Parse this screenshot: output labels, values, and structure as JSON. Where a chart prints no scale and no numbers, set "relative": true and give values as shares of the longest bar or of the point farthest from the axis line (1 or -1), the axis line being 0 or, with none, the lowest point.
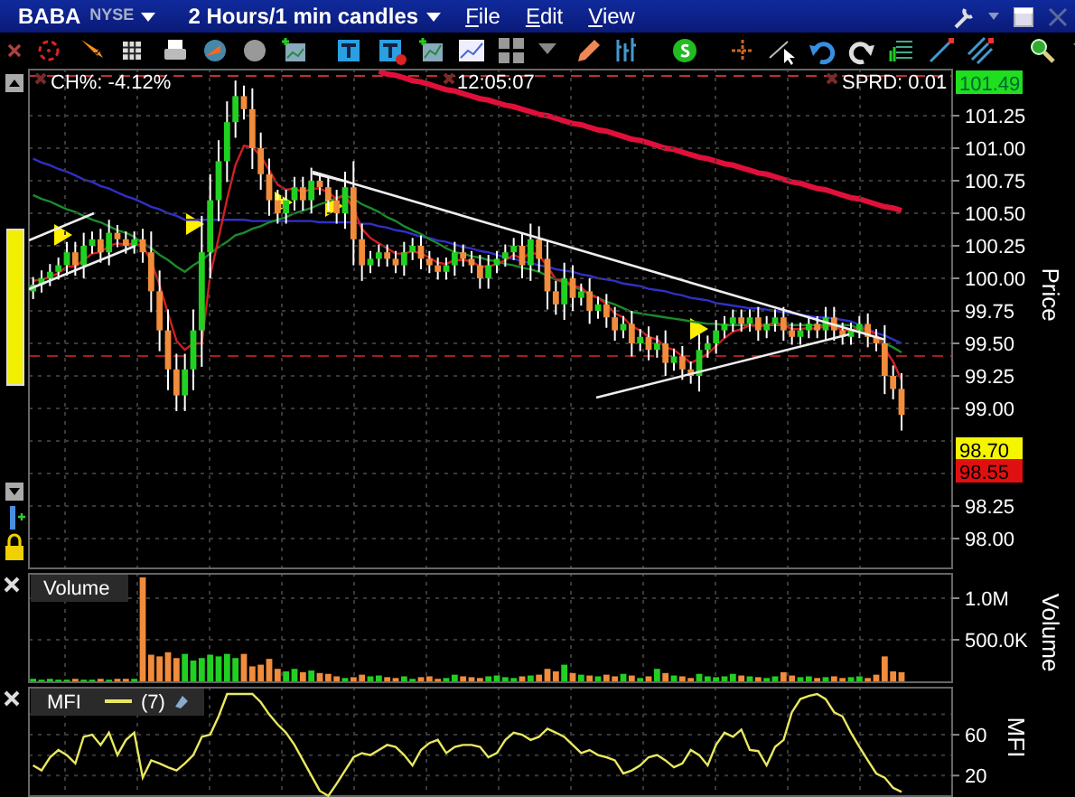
{
  "header": {
    "symbol": "BABA",
    "exchange": "NYSE",
    "timeframe": "2 Hours/1 min candles",
    "menu": [
      "File",
      "Edit",
      "View"
    ]
  },
  "price_panel": {
    "change": "CH%: -4.12%",
    "time": "12:05:07",
    "spread": "SPRD: 0.01",
    "price_labels": [
      {
        "text": "101.49",
        "color": "#1ee01e"
      },
      {
        "text": "98.70",
        "color": "#f5f500"
      },
      {
        "text": "98.55",
        "color": "#e01010"
      }
    ],
    "chart_data": {
      "type": "candlestick",
      "ylabel": "Price",
      "ylim": [
        97.764,
        101.611
      ],
      "grid": true,
      "categories": [
        null,
        null,
        null,
        null,
        null,
        null,
        null,
        null,
        null,
        null,
        null,
        null,
        null,
        null,
        null,
        null,
        null,
        null,
        null,
        null,
        null,
        null,
        null,
        null,
        null,
        null,
        null,
        null,
        null,
        null,
        null,
        null,
        null,
        null,
        null,
        null,
        null,
        null,
        null,
        null,
        null,
        null,
        null,
        null,
        null,
        null,
        null,
        null,
        null,
        null,
        null,
        null,
        null,
        null,
        null,
        null,
        null,
        null,
        null,
        null,
        null,
        null,
        null,
        null,
        null,
        null,
        null,
        null,
        null,
        null,
        null,
        null,
        null,
        null,
        null,
        null,
        null,
        null,
        null,
        null,
        null,
        null,
        null,
        null,
        null,
        null,
        null,
        null,
        null,
        null,
        null,
        null,
        null,
        null,
        null,
        null,
        null,
        null,
        null,
        null,
        null,
        null,
        null,
        null
      ],
      "yticks": [
        {
          "value": 98,
          "label": "98.00"
        },
        {
          "value": 98.25,
          "label": "98.25"
        },
        {
          "value": 99,
          "label": "99.00"
        },
        {
          "value": 99.25,
          "label": "99.25"
        },
        {
          "value": 99.5,
          "label": "99.50"
        },
        {
          "value": 99.75,
          "label": "99.75"
        },
        {
          "value": 100,
          "label": "100.00"
        },
        {
          "value": 100.25,
          "label": "100.25"
        },
        {
          "value": 100.5,
          "label": "100.50"
        },
        {
          "value": 100.75,
          "label": "100.75"
        },
        {
          "value": 101,
          "label": "101.00"
        },
        {
          "value": 101.25,
          "label": "101.25"
        }
      ],
      "ohlc": [
        [
          99.9,
          100.01,
          99.84,
          99.95
        ],
        [
          99.95,
          100.06,
          99.89,
          100.0
        ],
        [
          100.0,
          100.11,
          99.94,
          100.05
        ],
        [
          100.05,
          100.16,
          99.99,
          100.1
        ],
        [
          100.1,
          100.28,
          100.02,
          100.2
        ],
        [
          100.2,
          100.28,
          100.02,
          100.1
        ],
        [
          100.1,
          100.35,
          100.0,
          100.25
        ],
        [
          100.25,
          100.36,
          100.19,
          100.3
        ],
        [
          100.3,
          100.38,
          100.12,
          100.2
        ],
        [
          100.2,
          100.45,
          100.1,
          100.35
        ],
        [
          100.35,
          100.41,
          100.24,
          100.3
        ],
        [
          100.3,
          100.36,
          100.19,
          100.25
        ],
        [
          100.25,
          100.36,
          100.19,
          100.3
        ],
        [
          100.3,
          100.38,
          100.12,
          100.2
        ],
        [
          100.2,
          100.36,
          99.74,
          99.9
        ],
        [
          99.9,
          100.06,
          99.44,
          99.6
        ],
        [
          99.6,
          99.76,
          99.14,
          99.3
        ],
        [
          99.3,
          99.42,
          98.98,
          99.1
        ],
        [
          99.1,
          99.42,
          98.98,
          99.3
        ],
        [
          99.3,
          99.76,
          99.14,
          99.6
        ],
        [
          99.6,
          100.48,
          99.32,
          100.2
        ],
        [
          100.2,
          100.8,
          100.0,
          100.6
        ],
        [
          100.6,
          101.06,
          100.44,
          100.9
        ],
        [
          100.9,
          101.36,
          100.74,
          101.2
        ],
        [
          101.2,
          101.52,
          101.08,
          101.4
        ],
        [
          101.4,
          101.48,
          101.22,
          101.3
        ],
        [
          101.3,
          101.46,
          100.84,
          101.0
        ],
        [
          101.0,
          101.12,
          100.68,
          100.8
        ],
        [
          100.8,
          100.92,
          100.48,
          100.6
        ],
        [
          100.6,
          100.68,
          100.42,
          100.5
        ],
        [
          100.5,
          100.68,
          100.42,
          100.6
        ],
        [
          100.6,
          100.78,
          100.52,
          100.7
        ],
        [
          100.7,
          100.78,
          100.52,
          100.6
        ],
        [
          100.6,
          100.85,
          100.5,
          100.75
        ],
        [
          100.75,
          100.81,
          100.64,
          100.7
        ],
        [
          100.7,
          100.78,
          100.52,
          100.6
        ],
        [
          100.6,
          100.68,
          100.42,
          100.5
        ],
        [
          100.5,
          100.82,
          100.38,
          100.7
        ],
        [
          100.7,
          100.9,
          100.1,
          100.3
        ],
        [
          100.3,
          100.42,
          99.98,
          100.1
        ],
        [
          100.1,
          100.21,
          100.04,
          100.15
        ],
        [
          100.15,
          100.26,
          100.09,
          100.2
        ],
        [
          100.2,
          100.26,
          100.09,
          100.15
        ],
        [
          100.15,
          100.21,
          100.04,
          100.1
        ],
        [
          100.1,
          100.28,
          100.02,
          100.2
        ],
        [
          100.2,
          100.31,
          100.14,
          100.25
        ],
        [
          100.25,
          100.33,
          100.07,
          100.15
        ],
        [
          100.15,
          100.21,
          100.04,
          100.1
        ],
        [
          100.1,
          100.16,
          99.99,
          100.05
        ],
        [
          100.05,
          100.16,
          99.99,
          100.1
        ],
        [
          100.1,
          100.28,
          100.02,
          100.2
        ],
        [
          100.2,
          100.26,
          100.09,
          100.15
        ],
        [
          100.15,
          100.21,
          100.04,
          100.1
        ],
        [
          100.1,
          100.18,
          99.92,
          100.0
        ],
        [
          100.0,
          100.18,
          99.92,
          100.1
        ],
        [
          100.1,
          100.21,
          100.04,
          100.15
        ],
        [
          100.15,
          100.26,
          100.09,
          100.2
        ],
        [
          100.2,
          100.31,
          100.14,
          100.25
        ],
        [
          100.25,
          100.35,
          100.0,
          100.1
        ],
        [
          100.1,
          100.42,
          99.98,
          100.3
        ],
        [
          100.3,
          100.4,
          100.05,
          100.15
        ],
        [
          100.15,
          100.29,
          99.76,
          99.9
        ],
        [
          99.9,
          99.98,
          99.72,
          99.8
        ],
        [
          99.8,
          100.12,
          99.68,
          100.0
        ],
        [
          100.0,
          100.1,
          99.75,
          99.85
        ],
        [
          99.85,
          99.96,
          99.79,
          99.9
        ],
        [
          99.9,
          100.0,
          99.65,
          99.75
        ],
        [
          99.75,
          99.86,
          99.69,
          99.8
        ],
        [
          99.8,
          99.88,
          99.62,
          99.7
        ],
        [
          99.7,
          99.78,
          99.52,
          99.6
        ],
        [
          99.6,
          99.71,
          99.54,
          99.65
        ],
        [
          99.65,
          99.75,
          99.4,
          99.5
        ],
        [
          99.5,
          99.61,
          99.44,
          99.55
        ],
        [
          99.55,
          99.63,
          99.37,
          99.45
        ],
        [
          99.45,
          99.56,
          99.39,
          99.5
        ],
        [
          99.5,
          99.6,
          99.25,
          99.35
        ],
        [
          99.35,
          99.46,
          99.29,
          99.4
        ],
        [
          99.4,
          99.48,
          99.22,
          99.3
        ],
        [
          99.3,
          99.36,
          99.19,
          99.25
        ],
        [
          99.25,
          99.57,
          99.13,
          99.45
        ],
        [
          99.45,
          99.56,
          99.39,
          99.5
        ],
        [
          99.5,
          99.68,
          99.42,
          99.6
        ],
        [
          99.6,
          99.71,
          99.54,
          99.65
        ],
        [
          99.65,
          99.76,
          99.59,
          99.7
        ],
        [
          99.7,
          99.76,
          99.59,
          99.65
        ],
        [
          99.65,
          99.76,
          99.59,
          99.7
        ],
        [
          99.7,
          99.78,
          99.52,
          99.6
        ],
        [
          99.6,
          99.71,
          99.54,
          99.65
        ],
        [
          99.65,
          99.76,
          99.59,
          99.7
        ],
        [
          99.7,
          99.78,
          99.52,
          99.6
        ],
        [
          99.6,
          99.66,
          99.49,
          99.55
        ],
        [
          99.55,
          99.66,
          99.49,
          99.6
        ],
        [
          99.6,
          99.71,
          99.54,
          99.65
        ],
        [
          99.65,
          99.71,
          99.54,
          99.6
        ],
        [
          99.6,
          99.78,
          99.52,
          99.7
        ],
        [
          99.7,
          99.78,
          99.52,
          99.6
        ],
        [
          99.6,
          99.66,
          99.49,
          99.55
        ],
        [
          99.55,
          99.66,
          99.49,
          99.6
        ],
        [
          99.6,
          99.71,
          99.54,
          99.65
        ],
        [
          99.65,
          99.73,
          99.47,
          99.55
        ],
        [
          99.55,
          99.61,
          99.44,
          99.5
        ],
        [
          99.5,
          99.64,
          99.11,
          99.25
        ],
        [
          99.25,
          99.33,
          99.07,
          99.15
        ],
        [
          99.15,
          99.27,
          98.83,
          98.95
        ]
      ]
    },
    "averages": {
      "chart_data": {
        "type": "line",
        "relative": true,
        "ylim": [
          97.764,
          101.611
        ],
        "series": [
          {
            "color": "#3030c8",
            "values": [
              100.92,
              100.89,
              100.87,
              100.84,
              100.82,
              100.79,
              100.76,
              100.74,
              100.71,
              100.69,
              100.66,
              100.63,
              100.61,
              100.58,
              100.55,
              100.53,
              100.5,
              100.48,
              100.45,
              100.45,
              100.45,
              100.45,
              100.45,
              100.45,
              100.45,
              100.45,
              100.44,
              100.44,
              100.44,
              100.44,
              100.44,
              100.44,
              100.44,
              100.44,
              100.43,
              100.43,
              100.43,
              100.43,
              100.43,
              100.42,
              100.42,
              100.4,
              100.39,
              100.37,
              100.36,
              100.34,
              100.32,
              100.31,
              100.29,
              100.28,
              100.26,
              100.24,
              100.23,
              100.21,
              100.2,
              100.18,
              100.16,
              100.15,
              100.13,
              100.12,
              100.1,
              100.09,
              100.07,
              100.06,
              100.05,
              100.03,
              100.02,
              100.0,
              99.99,
              99.98,
              99.96,
              99.95,
              99.94,
              99.92,
              99.91,
              99.9,
              99.88,
              99.87,
              99.85,
              99.84,
              99.83,
              99.81,
              99.8,
              99.79,
              99.78,
              99.77,
              99.77,
              99.76,
              99.75,
              99.74,
              99.73,
              99.72,
              99.71,
              99.7,
              99.7,
              99.69,
              99.68,
              99.67,
              99.64,
              99.61,
              99.58,
              99.56,
              99.53,
              99.5
            ]
          },
          {
            "color": "#1c8a2c",
            "values": [
              100.64,
              100.61,
              100.59,
              100.56,
              100.53,
              100.51,
              100.48,
              100.45,
              100.43,
              100.4,
              100.37,
              100.35,
              100.32,
              100.27,
              100.23,
              100.18,
              100.14,
              100.09,
              100.05,
              100.1,
              100.14,
              100.19,
              100.24,
              100.28,
              100.33,
              100.35,
              100.38,
              100.4,
              100.43,
              100.45,
              100.47,
              100.5,
              100.52,
              100.54,
              100.57,
              100.59,
              100.62,
              100.64,
              100.61,
              100.57,
              100.54,
              100.51,
              100.47,
              100.44,
              100.4,
              100.37,
              100.34,
              100.3,
              100.27,
              100.23,
              100.2,
              100.19,
              100.17,
              100.16,
              100.14,
              100.13,
              100.11,
              100.1,
              100.08,
              100.07,
              100.05,
              100.02,
              99.99,
              99.97,
              99.94,
              99.91,
              99.88,
              99.85,
              99.82,
              99.8,
              99.77,
              99.74,
              99.73,
              99.72,
              99.71,
              99.7,
              99.69,
              99.68,
              99.67,
              99.66,
              99.65,
              99.65,
              99.64,
              99.64,
              99.64,
              99.64,
              99.64,
              99.64,
              99.64,
              99.64,
              99.64,
              99.64,
              99.64,
              99.64,
              99.64,
              99.64,
              99.64,
              99.64,
              99.61,
              99.57,
              99.54,
              99.5,
              99.47,
              99.43
            ]
          },
          {
            "color": "#d02020",
            "values": [
              99.98,
              99.99,
              100.01,
              100.04,
              100.09,
              100.09,
              100.14,
              100.19,
              100.2,
              100.25,
              100.27,
              100.26,
              100.27,
              100.25,
              100.13,
              99.95,
              99.73,
              99.52,
              99.45,
              99.5,
              99.5,
              100.02,
              100.31,
              100.61,
              100.87,
              101.02,
              101.01,
              100.94,
              100.83,
              100.72,
              100.68,
              100.69,
              100.66,
              100.69,
              100.69,
              100.66,
              100.61,
              100.64,
              100.53,
              100.38,
              100.31,
              100.27,
              100.23,
              100.19,
              100.19,
              100.21,
              100.19,
              100.16,
              100.12,
              100.11,
              100.14,
              100.14,
              100.13,
              100.09,
              100.09,
              100.11,
              100.14,
              100.18,
              100.15,
              100.2,
              100.18,
              100.09,
              99.99,
              99.99,
              99.94,
              99.93,
              99.87,
              99.85,
              99.8,
              99.73,
              99.7,
              99.63,
              99.6,
              99.55,
              99.53,
              99.47,
              99.45,
              99.4,
              99.35,
              99.38,
              99.42,
              99.48,
              99.54,
              99.59,
              99.61,
              99.64,
              99.63,
              99.64,
              99.66,
              99.64,
              99.61,
              99.61,
              99.62,
              99.61,
              99.64,
              99.63,
              99.6,
              99.6,
              99.62,
              99.6,
              99.57,
              99.46,
              99.36,
              99.22
            ]
          },
          {
            "color": "#e0103a",
            "values": [
              null,
              null,
              null,
              null,
              null,
              null,
              null,
              null,
              null,
              null,
              null,
              null,
              null,
              null,
              null,
              null,
              null,
              null,
              null,
              null,
              null,
              null,
              null,
              null,
              null,
              null,
              null,
              null,
              null,
              null,
              null,
              null,
              null,
              null,
              null,
              null,
              null,
              null,
              null,
              null,
              null,
              101.59,
              101.57,
              101.56,
              101.54,
              101.52,
              101.51,
              101.49,
              101.47,
              101.45,
              101.44,
              101.42,
              101.4,
              101.38,
              101.37,
              101.35,
              101.33,
              101.32,
              101.3,
              101.28,
              101.26,
              101.25,
              101.23,
              101.21,
              101.19,
              101.18,
              101.16,
              101.14,
              101.13,
              101.11,
              101.09,
              101.07,
              101.06,
              101.04,
              101.02,
              101.0,
              100.99,
              100.97,
              100.95,
              100.93,
              100.92,
              100.9,
              100.88,
              100.87,
              100.85,
              100.83,
              100.81,
              100.8,
              100.78,
              100.76,
              100.74,
              100.73,
              100.71,
              100.69,
              100.68,
              100.66,
              100.64,
              100.62,
              100.61,
              100.59,
              100.57,
              100.55,
              100.54,
              100.52
            ]
          }
        ]
      }
    }
  },
  "volume_panel": {
    "title": "Volume",
    "chart_data": {
      "type": "bar",
      "ylabel": "Volume",
      "ylim": [
        0,
        1304000
      ],
      "grid": true,
      "yticks": [
        {
          "value": 500000,
          "label": "500.0K"
        },
        {
          "value": 1000000,
          "label": "1.0M"
        }
      ],
      "series": [
        {
          "color": "#22d022",
          "values": [
            30000,
            20000,
            30000,
            20000,
            20000,
            null,
            20000,
            20000,
            null,
            20000,
            null,
            null,
            30000,
            null,
            null,
            null,
            null,
            null,
            330000,
            250000,
            280000,
            320000,
            300000,
            330000,
            280000,
            null,
            null,
            null,
            null,
            null,
            120000,
            150000,
            null,
            130000,
            null,
            null,
            null,
            40000,
            null,
            null,
            60000,
            70000,
            null,
            null,
            60000,
            30000,
            null,
            null,
            null,
            40000,
            80000,
            null,
            null,
            null,
            60000,
            70000,
            50000,
            40000,
            null,
            70000,
            null,
            null,
            null,
            200000,
            null,
            80000,
            null,
            60000,
            null,
            null,
            90000,
            null,
            40000,
            null,
            150000,
            null,
            70000,
            null,
            null,
            90000,
            60000,
            50000,
            60000,
            90000,
            null,
            60000,
            null,
            40000,
            60000,
            null,
            null,
            50000,
            60000,
            null,
            50000,
            null,
            null,
            50000,
            60000,
            null,
            null,
            null,
            null,
            null
          ]
        },
        {
          "color": "#f08c3c",
          "values": [
            null,
            null,
            null,
            null,
            null,
            30000,
            null,
            null,
            30000,
            null,
            30000,
            30000,
            null,
            1250000,
            320000,
            300000,
            350000,
            280000,
            null,
            null,
            null,
            null,
            null,
            null,
            null,
            330000,
            180000,
            200000,
            270000,
            150000,
            null,
            null,
            110000,
            null,
            100000,
            90000,
            60000,
            null,
            50000,
            80000,
            null,
            null,
            50000,
            40000,
            null,
            null,
            50000,
            60000,
            30000,
            null,
            null,
            60000,
            50000,
            40000,
            null,
            null,
            null,
            null,
            60000,
            null,
            80000,
            150000,
            120000,
            null,
            100000,
            null,
            70000,
            null,
            80000,
            60000,
            null,
            70000,
            null,
            60000,
            null,
            100000,
            null,
            60000,
            40000,
            null,
            null,
            null,
            null,
            null,
            70000,
            null,
            50000,
            null,
            null,
            110000,
            70000,
            null,
            null,
            40000,
            null,
            60000,
            40000,
            null,
            null,
            40000,
            80000,
            300000,
            120000,
            110000
          ]
        }
      ]
    }
  },
  "mfi_panel": {
    "title": "MFI",
    "period": "(7)",
    "chart_data": {
      "type": "line",
      "ylabel": "MFI",
      "ylim": [
        -1,
        107
      ],
      "yticks": [
        20,
        60
      ],
      "grid": true,
      "series": [
        {
          "color": "#e8e860",
          "values": [
            30,
            25,
            38,
            45,
            40,
            32,
            58,
            60,
            50,
            62,
            40,
            55,
            62,
            18,
            35,
            32,
            28,
            25,
            32,
            40,
            58,
            60,
            78,
            100,
            100,
            100,
            100,
            92,
            80,
            70,
            62,
            50,
            35,
            20,
            5,
            0,
            12,
            25,
            38,
            42,
            40,
            45,
            50,
            48,
            40,
            30,
            45,
            52,
            55,
            42,
            48,
            50,
            50,
            48,
            38,
            42,
            55,
            62,
            60,
            55,
            58,
            66,
            62,
            58,
            50,
            42,
            45,
            40,
            38,
            35,
            22,
            25,
            30,
            38,
            40,
            35,
            28,
            32,
            45,
            40,
            30,
            50,
            62,
            58,
            65,
            45,
            44,
            30,
            48,
            55,
            82,
            95,
            98,
            100,
            95,
            82,
            78,
            62,
            48,
            35,
            22,
            18,
            8,
            4
          ]
        }
      ]
    }
  }
}
